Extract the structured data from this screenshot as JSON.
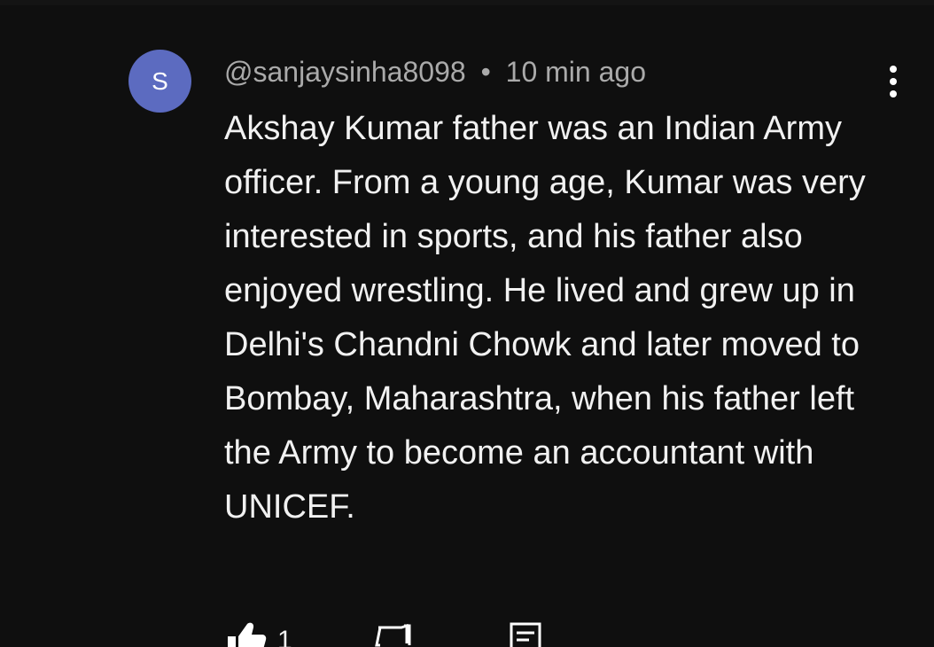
{
  "comment": {
    "avatar_letter": "S",
    "author": "@sanjaysinha8098",
    "separator": "•",
    "timestamp": "10 min ago",
    "text": "Akshay Kumar father was an Indian Army officer. From a young age, Kumar was very interested in sports, and his father also enjoyed wrestling. He lived and grew up in Delhi's Chandni Chowk and later moved to Bombay, Maharashtra, when his father left the Army to become an accountant with UNICEF.",
    "like_count": "1"
  },
  "colors": {
    "background": "#0f0f0f",
    "avatar": "#5c6bc0",
    "meta_text": "#aaaaaa",
    "body_text": "#f1f1f1"
  },
  "icons": {
    "more": "vertical-dots-icon",
    "like": "thumbs-up-icon",
    "dislike": "thumbs-down-icon",
    "reply": "reply-icon"
  }
}
